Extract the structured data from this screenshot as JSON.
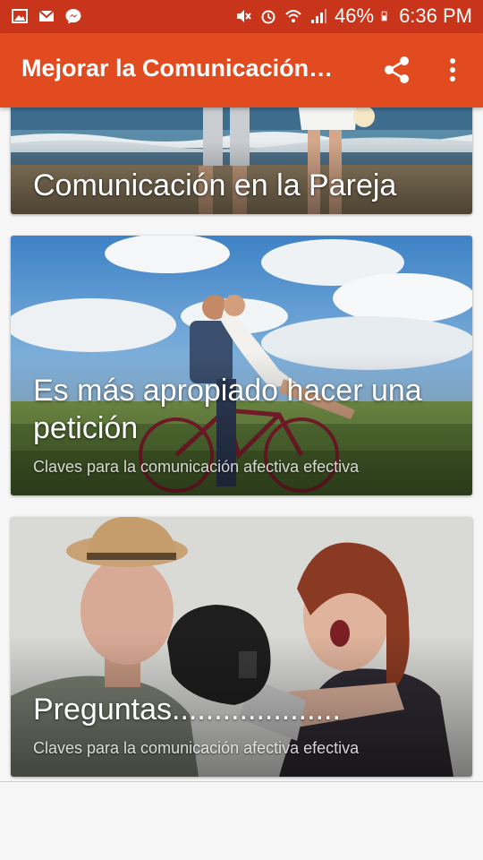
{
  "status_bar": {
    "battery": "46%",
    "time": "6:36 PM",
    "icons": [
      "image-icon",
      "mail-icon",
      "messenger-icon",
      "mute-icon",
      "alarm-icon",
      "wifi-icon",
      "signal-icon",
      "battery-icon"
    ]
  },
  "app_bar": {
    "title": "Mejorar la Comunicación…",
    "icons": [
      "share-icon",
      "more-vert-icon"
    ]
  },
  "cards": [
    {
      "title": "Comunicación en la Pareja",
      "subtitle": ""
    },
    {
      "title": "Es más apropiado hacer una petición",
      "subtitle": "Claves para la comunicación afectiva efectiva"
    },
    {
      "title": "Preguntas....................",
      "subtitle": "Claves para la comunicación afectiva efectiva"
    }
  ],
  "colors": {
    "status_bar": "#c9351a",
    "app_bar": "#e24a1f",
    "background": "#f6f6f6"
  }
}
